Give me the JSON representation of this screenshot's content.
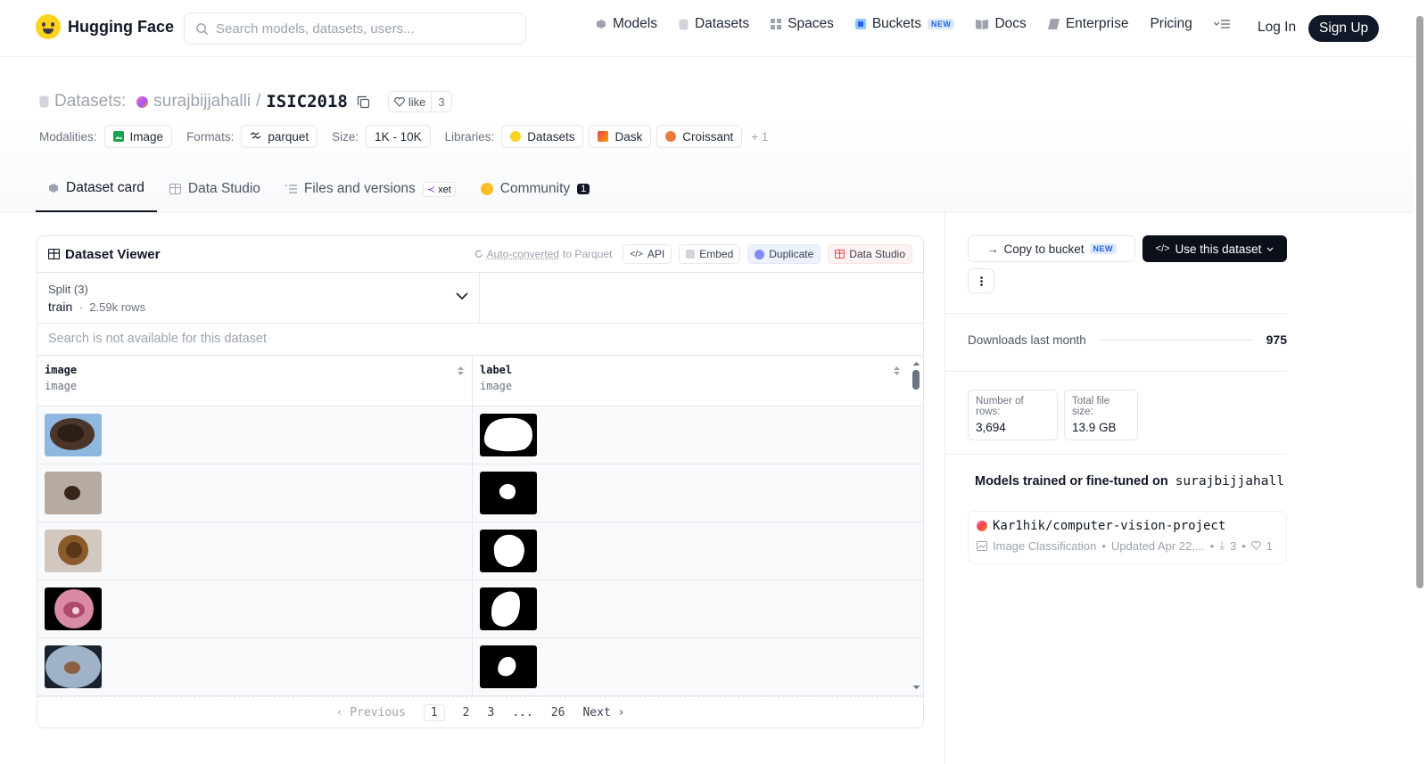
{
  "brand": {
    "name": "Hugging Face"
  },
  "search": {
    "placeholder": "Search models, datasets, users..."
  },
  "nav": {
    "links": [
      "Models",
      "Datasets",
      "Spaces",
      "Buckets",
      "Docs",
      "Enterprise",
      "Pricing"
    ],
    "new_badge": "NEW",
    "login": "Log In",
    "signup": "Sign Up"
  },
  "repo": {
    "kind": "Datasets:",
    "owner": "surajbijjahalli",
    "separator": "/",
    "name": "ISIC2018",
    "like_label": "like",
    "like_count": "3"
  },
  "tags": {
    "modalities_label": "Modalities:",
    "modalities": [
      "Image"
    ],
    "formats_label": "Formats:",
    "formats": [
      "parquet"
    ],
    "size_label": "Size:",
    "size": [
      "1K - 10K"
    ],
    "libraries_label": "Libraries:",
    "libraries": [
      "Datasets",
      "Dask",
      "Croissant"
    ],
    "more": "+ 1"
  },
  "tabs": [
    {
      "label": "Dataset card"
    },
    {
      "label": "Data Studio"
    },
    {
      "label": "Files and versions",
      "badge": "xet"
    },
    {
      "label": "Community",
      "badge": "1"
    }
  ],
  "viewer": {
    "title": "Dataset Viewer",
    "auto_converted": "Auto-converted",
    "to_parquet": "to Parquet",
    "actions": [
      "API",
      "Embed",
      "Duplicate",
      "Data Studio"
    ],
    "split_label": "Split (3)",
    "split_value": "train",
    "split_rows": "2.59k rows",
    "search_unavailable": "Search is not available for this dataset",
    "columns": [
      {
        "name": "image",
        "type": "image"
      },
      {
        "name": "label",
        "type": "image"
      }
    ],
    "pager": {
      "previous": "Previous",
      "pages": [
        "1",
        "2",
        "3",
        "...",
        "26"
      ],
      "next": "Next",
      "current": "1"
    }
  },
  "sidebar": {
    "copy_to_bucket": "Copy to bucket",
    "use_dataset": "Use this dataset",
    "downloads_label": "Downloads last month",
    "downloads_value": "975",
    "num_rows_label": "Number of rows:",
    "num_rows_value": "3,694",
    "file_size_label": "Total file size:",
    "file_size_value": "13.9 GB",
    "models_title": "Models trained or fine-tuned on",
    "models_title_repo": "surajbijjahall...",
    "model": {
      "name": "Kar1hik/computer-vision-project",
      "task": "Image Classification",
      "updated": "Updated Apr 22,...",
      "downloads": "3",
      "likes": "1"
    }
  },
  "colors": {
    "accent": "#111827",
    "brand_yellow": "#ffd21e",
    "border": "#e5e7eb"
  }
}
